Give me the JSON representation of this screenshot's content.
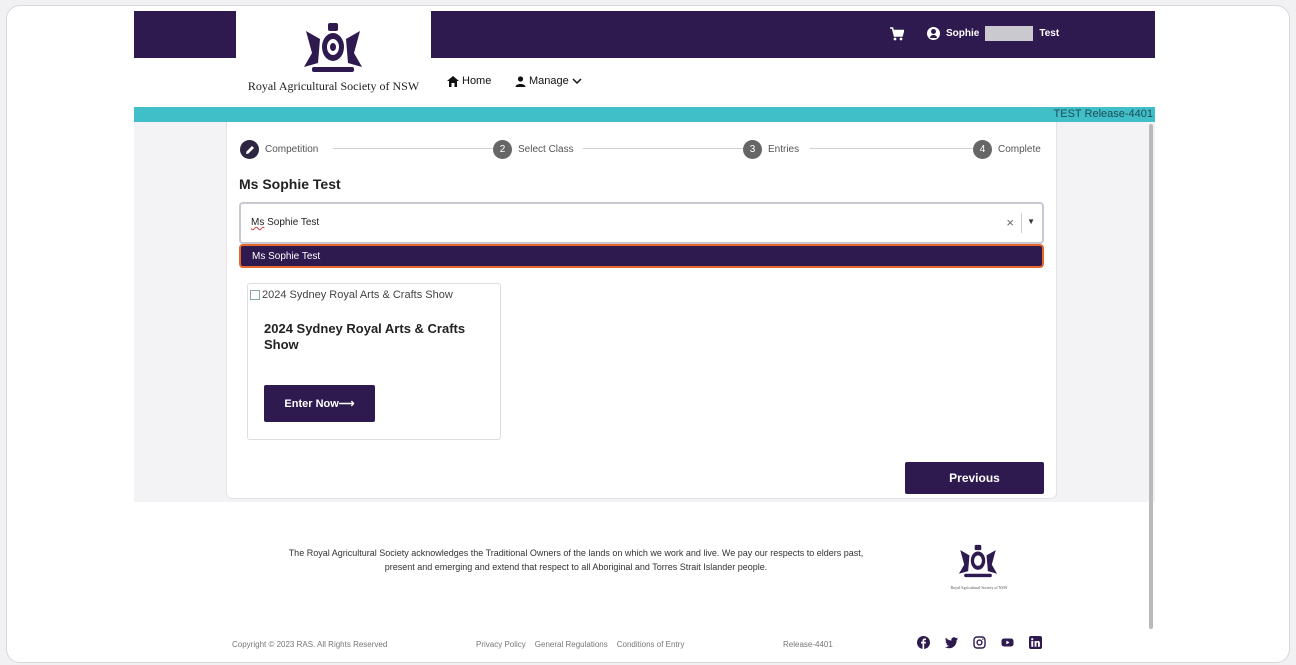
{
  "header": {
    "logo_text": "Royal Agricultural Society of NSW",
    "nav_home": "Home",
    "nav_manage": "Manage",
    "user_first": "Sophie",
    "user_last": "Test",
    "release_label": "TEST Release-4401"
  },
  "stepper": {
    "steps": [
      {
        "number": "",
        "label": "Competition"
      },
      {
        "number": "2",
        "label": "Select Class"
      },
      {
        "number": "3",
        "label": "Entries"
      },
      {
        "number": "4",
        "label": "Complete"
      }
    ]
  },
  "main": {
    "person_name": "Ms Sophie Test",
    "select_value_prefix": "Ms",
    "select_value_rest": " Sophie Test",
    "select_clear": "×",
    "dropdown_option": "Ms Sophie Test",
    "show_image_alt": "2024 Sydney Royal Arts & Crafts Show",
    "show_title": "2024 Sydney Royal Arts & Crafts Show",
    "enter_button": "Enter Now⟶",
    "previous_button": "Previous"
  },
  "footer": {
    "acknowledgement_line1": "The Royal Agricultural Society acknowledges the Traditional Owners of the lands on which we work and live. We pay our respects to elders past,",
    "acknowledgement_line2": "present and emerging and extend that respect to all Aboriginal and Torres Strait Islander people.",
    "crest_text": "Royal Agricultural Society of NSW",
    "copyright": "Copyright © 2023 RAS. All Rights Reserved",
    "links": [
      "Privacy Policy",
      "General Regulations",
      "Conditions of Entry"
    ],
    "release": "Release-4401",
    "socials": [
      "facebook-icon",
      "twitter-icon",
      "instagram-icon",
      "youtube-icon",
      "linkedin-icon"
    ]
  },
  "colors": {
    "brand_purple": "#2e1a4f",
    "teal_bar": "#41bfc9",
    "focus_orange": "#e8672f"
  }
}
